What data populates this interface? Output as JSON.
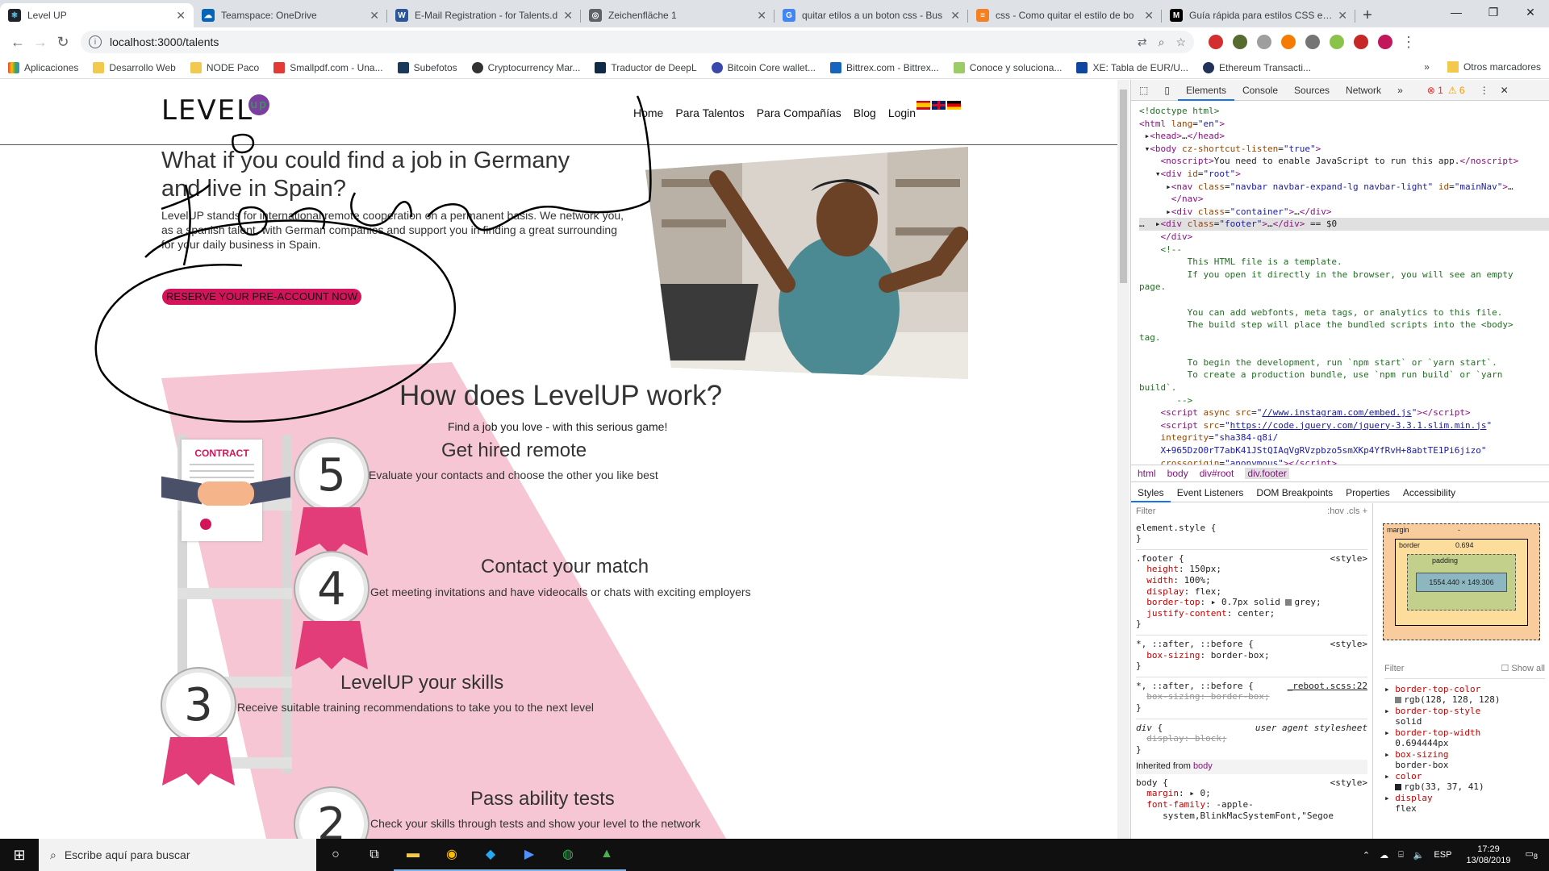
{
  "browser": {
    "tabs": [
      {
        "title": "Level UP",
        "favicon_color": "#20232a",
        "active": true
      },
      {
        "title": "Teamspace: OneDrive",
        "favicon_color": "#0364b8"
      },
      {
        "title": "E-Mail Registration - for Talents.d",
        "favicon_color": "#2b579a"
      },
      {
        "title": "Zeichenfläche 1",
        "favicon_color": "#5f6368"
      },
      {
        "title": "quitar etilos a un boton css - Bus",
        "favicon_color": "#4285f4"
      },
      {
        "title": "css - Como quitar el estilo de bo",
        "favicon_color": "#f48024"
      },
      {
        "title": "Guía rápida para estilos CSS en b",
        "favicon_color": "#000000"
      }
    ],
    "url": "localhost:3000/talents",
    "bookmarks": [
      "Aplicaciones",
      "Desarrollo Web",
      "NODE Paco",
      "Smallpdf.com - Una...",
      "Subefotos",
      "Cryptocurrency Mar...",
      "Traductor de DeepL",
      "Bitcoin Core wallet...",
      "Bittrex.com - Bittrex...",
      "Conoce y soluciona...",
      "XE: Tabla de EUR/U...",
      "Ethereum Transacti..."
    ],
    "bookmarks_more": "»",
    "other_bookmarks": "Otros marcadores"
  },
  "site": {
    "logo": "LEVEL",
    "logo_up": "up",
    "nav": [
      "Home",
      "Para Talentos",
      "Para Compañías",
      "Blog",
      "Login"
    ],
    "hero_title": "What if you could find a job in Germany and live in Spain?",
    "hero_text": "LevelUP stands for international remote cooperation on a permanent basis. We network you, as a spanish talent, with German companies and support you in finding a great surrounding for your daily business in Spain.",
    "cta": "RESERVE YOUR PRE-ACCOUNT NOW",
    "section_title": "How does LevelUP work?",
    "section_sub": "Find a job you love - with this serious game!",
    "contract_label": "CONTRACT",
    "steps": [
      {
        "num": "5",
        "title": "Get hired remote",
        "text": "Evaluate your contacts and choose the other you like best"
      },
      {
        "num": "4",
        "title": "Contact your match",
        "text": "Get meeting invitations and have videocalls or chats with exciting employers"
      },
      {
        "num": "3",
        "title": "LevelUP your skills",
        "text": "Receive suitable training recommendations to take you to the next level"
      },
      {
        "num": "2",
        "title": "Pass ability tests",
        "text": "Check your skills through tests and show your level to the network"
      }
    ]
  },
  "devtools": {
    "tabs": [
      "Elements",
      "Console",
      "Sources",
      "Network",
      "»"
    ],
    "errors": "1",
    "warnings": "6",
    "breadcrumbs": [
      "html",
      "body",
      "div#root",
      "div.footer"
    ],
    "style_tabs": [
      "Styles",
      "Event Listeners",
      "DOM Breakpoints",
      "Properties",
      "Accessibility"
    ],
    "filter_placeholder": "Filter",
    "hov": ":hov",
    "cls": ".cls",
    "boxmodel": {
      "margin": "margin",
      "border": "border",
      "border_val": "0.694",
      "padding": "padding",
      "content": "1554.440 × 149.306",
      "dash": "-"
    },
    "computed_filter": "Filter",
    "show_all": "Show all",
    "inherited": "Inherited from",
    "inherited_from": "body"
  },
  "taskbar": {
    "search": "Escribe aquí para buscar",
    "lang": "ESP",
    "time": "17:29",
    "date": "13/08/2019",
    "notifications": "8"
  }
}
